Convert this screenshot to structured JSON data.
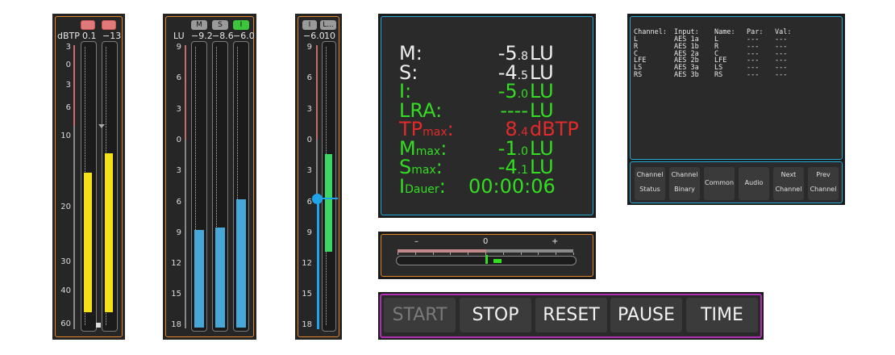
{
  "meter_tp": {
    "btn1": "",
    "btn2": "",
    "unit": "dBTP",
    "ch1_value": "0.1",
    "ch2_value": "−13",
    "scale": [
      "3",
      "0",
      "3",
      "6",
      "10",
      "20",
      "30",
      "40",
      "60"
    ],
    "ch1_level": 0.5,
    "ch2_level": 0.57
  },
  "meter_msi": {
    "btn_m": "M",
    "btn_s": "S",
    "btn_i": "I",
    "unit": "LU",
    "m_value": "−9.2",
    "s_value": "−8.6",
    "i_value": "−6.0",
    "scale": [
      "9",
      "6",
      "3",
      "0",
      "3",
      "6",
      "9",
      "12",
      "15",
      "18"
    ],
    "m_level": 0.35,
    "s_level": 0.36,
    "i_level": 0.46
  },
  "meter_range": {
    "btn_i": "I",
    "btn_l": "L...",
    "i_value": "−6.0",
    "l_value": "10",
    "scale": [
      "9",
      "6",
      "3",
      "0",
      "3",
      "6",
      "9",
      "12",
      "15",
      "18"
    ],
    "range_top": 0.63,
    "range_bottom": 0.28,
    "marker_level": 0.47
  },
  "loudness": {
    "rows": [
      {
        "key": "M:",
        "key_sub": "",
        "num": "-5",
        "dec": ".8",
        "unit": "LU",
        "color": "#eeeeee"
      },
      {
        "key": "S:",
        "key_sub": "",
        "num": "-4",
        "dec": ".5",
        "unit": "LU",
        "color": "#eeeeee"
      },
      {
        "key": "I:",
        "key_sub": "",
        "num": "-5",
        "dec": ".0",
        "unit": "LU",
        "color": "#33dd22"
      },
      {
        "key": "LRA:",
        "key_sub": "",
        "num": "----",
        "dec": "",
        "unit": "LU",
        "color": "#33dd22"
      },
      {
        "key": "TP",
        "key_sub": "max",
        "num": "8",
        "dec": ".4",
        "unit": "dBTP",
        "color": "#e22a2a"
      },
      {
        "key": "M",
        "key_sub": "max",
        "num": "-1",
        "dec": ".0",
        "unit": "LU",
        "color": "#33dd22"
      },
      {
        "key": "S",
        "key_sub": "max",
        "num": "-4",
        "dec": ".1",
        "unit": "LU",
        "color": "#33dd22"
      },
      {
        "key": "I",
        "key_sub": "Dauer",
        "num": "00:00:06",
        "dec": "",
        "unit": "",
        "color": "#33dd22"
      }
    ]
  },
  "balance": {
    "minus": "–",
    "zero": "0",
    "plus": "+",
    "position": 0.02
  },
  "transport": {
    "start": "START",
    "stop": "STOP",
    "reset": "RESET",
    "pause": "PAUSE",
    "time": "TIME"
  },
  "channels": {
    "headers": [
      "Channel:",
      "Input:",
      "Name:",
      "Par:",
      "Val:"
    ],
    "rows": [
      [
        "L",
        "AES 1a",
        "L",
        "---",
        "---"
      ],
      [
        "R",
        "AES 1b",
        "R",
        "---",
        "---"
      ],
      [
        "C",
        "AES 2a",
        "C",
        "---",
        "---"
      ],
      [
        "LFE",
        "AES 2b",
        "LFE",
        "---",
        "---"
      ],
      [
        "LS",
        "AES 3a",
        "LS",
        "---",
        "---"
      ],
      [
        "RS",
        "AES 3b",
        "RS",
        "---",
        "---"
      ]
    ],
    "buttons": [
      {
        "line1": "Channel",
        "line2": "Status"
      },
      {
        "line1": "Channel",
        "line2": "Binary"
      },
      {
        "line1": "Common",
        "line2": ""
      },
      {
        "line1": "Audio",
        "line2": ""
      },
      {
        "line1": "Next",
        "line2": "Channel"
      },
      {
        "line1": "Prev",
        "line2": "Channel"
      }
    ]
  },
  "colors": {
    "yellow": "#f5e11a",
    "blue": "#47a7d6",
    "green": "#33dd55",
    "red": "#e22a2a",
    "orange_border": "#e0862a",
    "cyan_border": "#27a9d8",
    "magenta_border": "#b02fb5"
  }
}
